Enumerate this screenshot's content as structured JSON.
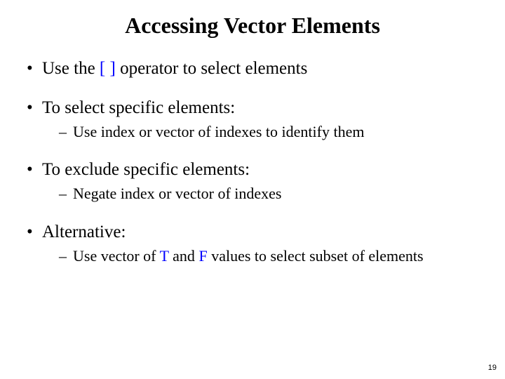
{
  "title": "Accessing Vector Elements",
  "b1": {
    "pre": "Use the ",
    "op": "[ ]",
    "post": " operator to select elements"
  },
  "b2": {
    "text": "To select specific elements:",
    "sub": "Use index or vector of indexes to identify them"
  },
  "b3": {
    "text": "To exclude specific elements:",
    "sub": "Negate index or vector of indexes"
  },
  "b4": {
    "text": "Alternative:",
    "sub_pre": "Use vector of ",
    "T": "T",
    "sub_mid": " and ",
    "F": "F",
    "sub_post": " values to select subset of elements"
  },
  "page": "19"
}
